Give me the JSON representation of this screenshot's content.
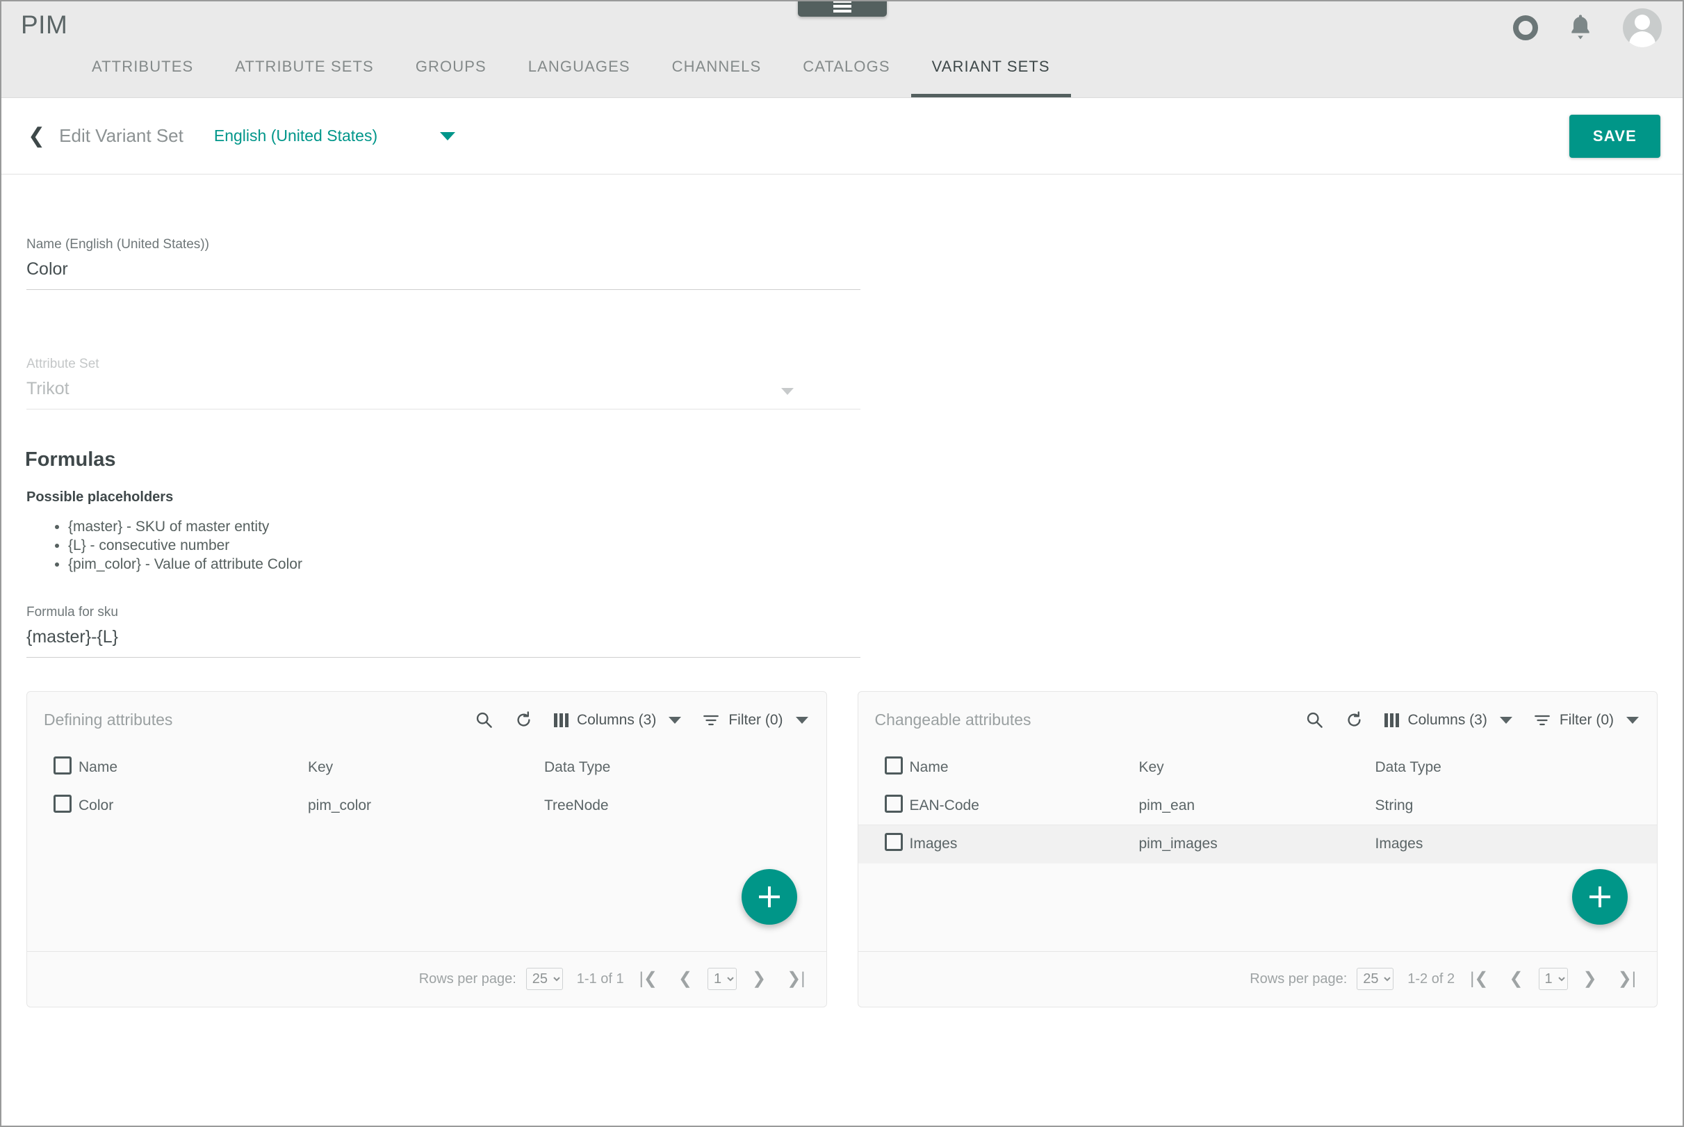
{
  "appbar": {
    "brand": "PIM",
    "menu_icon": "hamburger-menu-icon",
    "ring_icon": "circle-ring-icon",
    "bell_icon": "notification-bell-icon",
    "avatar_icon": "user-avatar-icon",
    "tabs": [
      {
        "label": "ATTRIBUTES",
        "active": false
      },
      {
        "label": "ATTRIBUTE SETS",
        "active": false
      },
      {
        "label": "GROUPS",
        "active": false
      },
      {
        "label": "LANGUAGES",
        "active": false
      },
      {
        "label": "CHANNELS",
        "active": false
      },
      {
        "label": "CATALOGS",
        "active": false
      },
      {
        "label": "VARIANT SETS",
        "active": true
      }
    ]
  },
  "subheader": {
    "back_icon": "back-chevron-icon",
    "title": "Edit Variant Set",
    "language": "English (United States)",
    "save_label": "SAVE"
  },
  "form": {
    "name_label": "Name (English (United States))",
    "name_value": "Color",
    "attrset_label": "Attribute Set",
    "attrset_value": "Trikot",
    "formulas_heading": "Formulas",
    "placeholders_heading": "Possible placeholders",
    "placeholders": [
      "{master} - SKU of master entity",
      "{L} - consecutive number",
      "{pim_color} - Value of attribute Color"
    ],
    "formula_label": "Formula for sku",
    "formula_value": "{master}-{L}"
  },
  "toolbar": {
    "search_icon": "search-icon",
    "refresh_icon": "refresh-icon",
    "columns_label": "Columns (3)",
    "filter_label": "Filter (0)"
  },
  "panels": [
    {
      "title": "Defining attributes",
      "columns": [
        "Name",
        "Key",
        "Data Type"
      ],
      "rows": [
        {
          "name": "Color",
          "key": "pim_color",
          "type": "TreeNode",
          "hover": false
        }
      ],
      "add_label": "add-attribute",
      "footer": {
        "rows_per_page_label": "Rows per page:",
        "rows_per_page_value": "25",
        "rows_per_page_options": [
          "25"
        ],
        "range": "1-1 of 1",
        "page_value": "1",
        "page_options": [
          "1"
        ],
        "first_icon": "first-page-icon",
        "prev_icon": "previous-page-icon",
        "next_icon": "next-page-icon",
        "last_icon": "last-page-icon"
      }
    },
    {
      "title": "Changeable attributes",
      "columns": [
        "Name",
        "Key",
        "Data Type"
      ],
      "rows": [
        {
          "name": "EAN-Code",
          "key": "pim_ean",
          "type": "String",
          "hover": false
        },
        {
          "name": "Images",
          "key": "pim_images",
          "type": "Images",
          "hover": true
        }
      ],
      "add_label": "add-attribute",
      "footer": {
        "rows_per_page_label": "Rows per page:",
        "rows_per_page_value": "25",
        "rows_per_page_options": [
          "25"
        ],
        "range": "1-2 of 2",
        "page_value": "1",
        "page_options": [
          "1"
        ],
        "first_icon": "first-page-icon",
        "prev_icon": "previous-page-icon",
        "next_icon": "next-page-icon",
        "last_icon": "last-page-icon"
      }
    }
  ],
  "colors": {
    "accent": "#009688",
    "appbar_bg": "#eaeaea",
    "active_tab": "#54605f",
    "panel_bg": "#fafafa"
  }
}
